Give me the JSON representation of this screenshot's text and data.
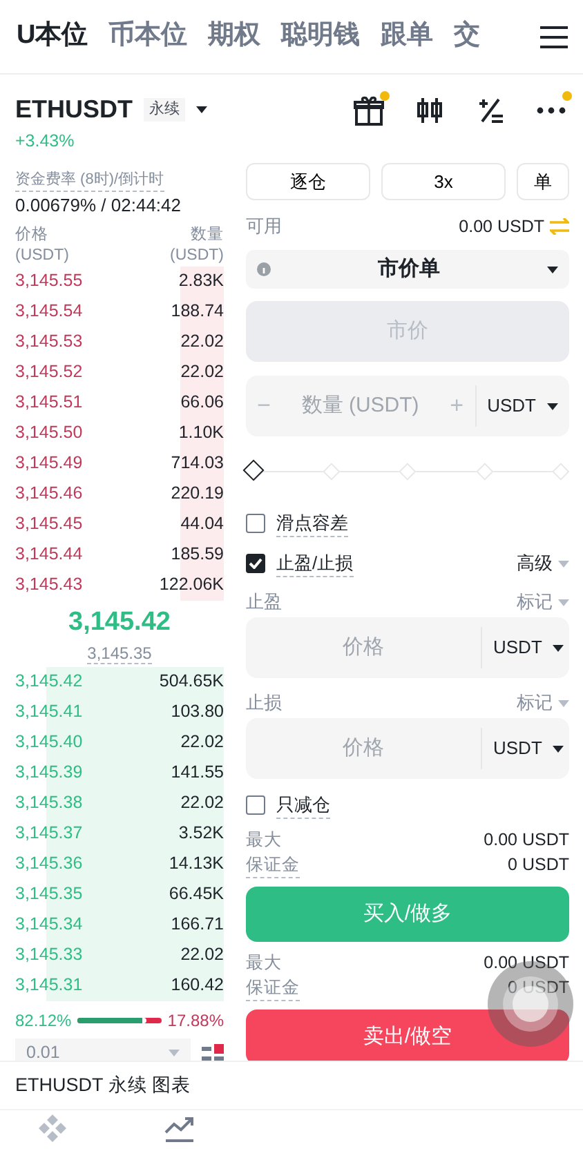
{
  "top_tabs": [
    {
      "label": "U本位",
      "selected": true
    },
    {
      "label": "币本位",
      "selected": false
    },
    {
      "label": "期权",
      "selected": false
    },
    {
      "label": "聪明钱",
      "selected": false
    },
    {
      "label": "跟单",
      "selected": false
    },
    {
      "label": "交",
      "selected": false
    }
  ],
  "symbol": {
    "name": "ETHUSDT",
    "tag": "永续",
    "change": "+3.43%"
  },
  "toolbar": [
    {
      "kind": "gift",
      "badge": true
    },
    {
      "kind": "candles",
      "badge": false
    },
    {
      "kind": "calculator",
      "badge": false
    },
    {
      "kind": "more",
      "badge": true
    }
  ],
  "funding": {
    "label": "资金费率 (8时)/倒计时",
    "value": "0.00679% / 02:44:42"
  },
  "book": {
    "price_header": "价格",
    "price_unit": "(USDT)",
    "qty_header": "数量",
    "qty_unit": "(USDT)",
    "asks": [
      {
        "price": "3,145.55",
        "qty": "2.83K"
      },
      {
        "price": "3,145.54",
        "qty": "188.74"
      },
      {
        "price": "3,145.53",
        "qty": "22.02"
      },
      {
        "price": "3,145.52",
        "qty": "22.02"
      },
      {
        "price": "3,145.51",
        "qty": "66.06"
      },
      {
        "price": "3,145.50",
        "qty": "1.10K"
      },
      {
        "price": "3,145.49",
        "qty": "714.03"
      },
      {
        "price": "3,145.46",
        "qty": "220.19"
      },
      {
        "price": "3,145.45",
        "qty": "44.04"
      },
      {
        "price": "3,145.44",
        "qty": "185.59"
      },
      {
        "price": "3,145.43",
        "qty": "122.06K"
      }
    ],
    "last_price": "3,145.42",
    "mark_price": "3,145.35",
    "bids": [
      {
        "price": "3,145.42",
        "qty": "504.65K"
      },
      {
        "price": "3,145.41",
        "qty": "103.80"
      },
      {
        "price": "3,145.40",
        "qty": "22.02"
      },
      {
        "price": "3,145.39",
        "qty": "141.55"
      },
      {
        "price": "3,145.38",
        "qty": "22.02"
      },
      {
        "price": "3,145.37",
        "qty": "3.52K"
      },
      {
        "price": "3,145.36",
        "qty": "14.13K"
      },
      {
        "price": "3,145.35",
        "qty": "66.45K"
      },
      {
        "price": "3,145.34",
        "qty": "166.71"
      },
      {
        "price": "3,145.33",
        "qty": "22.02"
      },
      {
        "price": "3,145.31",
        "qty": "160.42"
      }
    ],
    "buy_ratio": "82.12%",
    "sell_ratio": "17.88%",
    "level": 0.8212,
    "precision": "0.01"
  },
  "order_form": {
    "margin_mode": "逐仓",
    "leverage": "3x",
    "position_mode": "单",
    "available_label": "可用",
    "available": "0.00 USDT",
    "order_type": "市价单",
    "price_placeholder": "市价",
    "minus": "−",
    "qty_placeholder": "数量 (USDT)",
    "plus": "+",
    "qty_unit": "USDT",
    "slider": {
      "level": 0
    },
    "slippage": {
      "label": "滑点容差",
      "checked": false
    },
    "tpsl": {
      "label": "止盈/止损",
      "checked": true,
      "extra": "高级"
    },
    "take_profit": {
      "label": "止盈",
      "trigger": "标记",
      "placeholder": "价格",
      "unit": "USDT"
    },
    "stop_loss": {
      "label": "止损",
      "trigger": "标记",
      "placeholder": "价格",
      "unit": "USDT"
    },
    "reduce_only": {
      "label": "只减仓",
      "checked": false
    },
    "buy": {
      "max_label": "最大",
      "max": "0.00 USDT",
      "margin_label": "保证金",
      "margin": "0 USDT",
      "button": "买入/做多"
    },
    "sell": {
      "max_label": "最大",
      "max": "0.00 USDT",
      "margin_label": "保证金",
      "margin": "0 USDT",
      "button": "卖出/做空"
    }
  },
  "bottom": {
    "title": "ETHUSDT 永续 图表"
  }
}
